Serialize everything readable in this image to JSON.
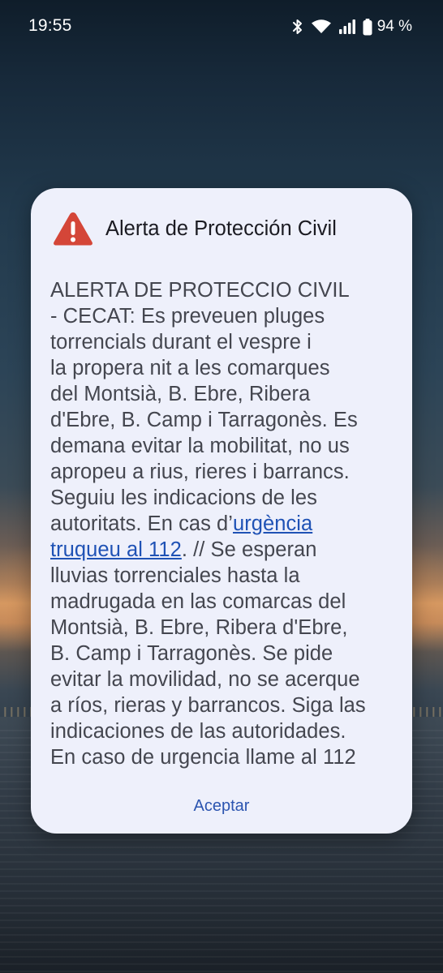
{
  "status_bar": {
    "time": "19:55",
    "battery": "94 %",
    "icons": [
      "bluetooth-icon",
      "wifi-icon",
      "cell-signal-icon",
      "battery-icon"
    ]
  },
  "dialog": {
    "icon": "warning-icon",
    "icon_color": "#d44638",
    "title": "Alerta de Protección Civil",
    "body_lines": {
      "l1": "ALERTA DE PROTECCIO CIVIL",
      "l2": "- CECAT: Es preveuen pluges",
      "l3": "torrencials durant el vespre i",
      "l4": "la propera nit a les comarques",
      "l5": "del Montsià, B. Ebre, Ribera",
      "l6": "d'Ebre, B. Camp i Tarragonès. Es",
      "l7": "demana evitar la mobilitat, no us",
      "l8": "apropeu a rius, rieres i barrancs.",
      "l9": "Seguiu les indicacions de les",
      "l10_pre": "autoritats. En cas d’",
      "l10_link": "urgència",
      "l11_link": "truqueu al 112",
      "l11_post": ". // Se esperan",
      "l12": "lluvias torrenciales hasta la",
      "l13": "madrugada en las comarcas del",
      "l14": "Montsià, B. Ebre, Ribera d'Ebre,",
      "l15": "B. Camp i Tarragonès. Se pide",
      "l16": "evitar la movilidad, no se acerque",
      "l17": "a ríos, rieras y barrancos. Siga las",
      "l18": "indicaciones de las autoridades.",
      "l19": "En caso de urgencia llame al 112"
    },
    "link_color": "#1f52b5",
    "accept_label": "Aceptar",
    "accent_color": "#2c55b0"
  }
}
